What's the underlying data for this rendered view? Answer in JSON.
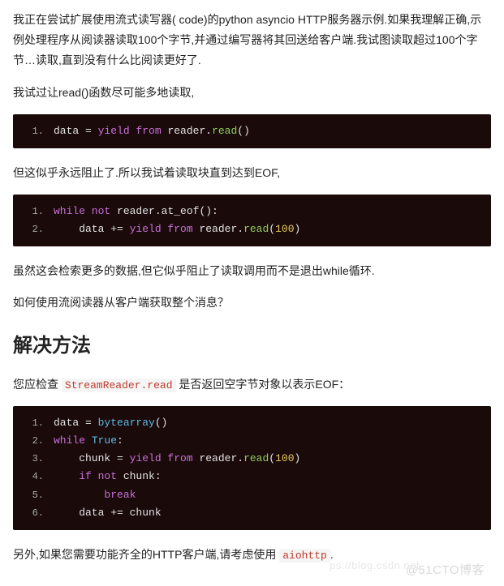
{
  "paragraphs": {
    "intro": "我正在尝试扩展使用流式读写器( code)的python asyncio HTTP服务器示例.如果我理解正确,示例处理程序从阅读器读取100个字节,并通过编写器将其回送给客户端.我试图读取超过100个字节…读取,直到没有什么比阅读更好了.",
    "trying_read": "我试过让read()函数尽可能多地读取,",
    "blocked_forever": "但这似乎永远阻止了.所以我试着读取块直到达到EOF,",
    "more_data": "虽然这会检索更多的数据,但它似乎阻止了读取调用而不是退出while循环.",
    "how_to": "如何使用流阅读器从客户端获取整个消息？",
    "check_eof_pre": "您应检查 ",
    "check_eof_code": "StreamReader.read",
    "check_eof_post": " 是否返回空字节对象以表示EOF：",
    "also_pre": "另外,如果您需要功能齐全的HTTP客户端,请考虑使用 ",
    "also_code": "aiohttp",
    "also_post": "."
  },
  "headings": {
    "solution": "解决方法"
  },
  "code": {
    "block1": [
      {
        "ln": "1.",
        "tokens": [
          {
            "c": "tok-var",
            "t": "data "
          },
          {
            "c": "tok-op",
            "t": "= "
          },
          {
            "c": "tok-kw",
            "t": "yield from "
          },
          {
            "c": "tok-var",
            "t": "reader"
          },
          {
            "c": "tok-dot",
            "t": "."
          },
          {
            "c": "tok-green",
            "t": "read"
          },
          {
            "c": "tok-paren",
            "t": "()"
          }
        ]
      }
    ],
    "block2": [
      {
        "ln": "1.",
        "tokens": [
          {
            "c": "tok-kw",
            "t": "while not "
          },
          {
            "c": "tok-var",
            "t": "reader"
          },
          {
            "c": "tok-dot",
            "t": "."
          },
          {
            "c": "tok-var",
            "t": "at_eof"
          },
          {
            "c": "tok-paren",
            "t": "():"
          }
        ]
      },
      {
        "ln": "2.",
        "tokens": [
          {
            "c": "tok-var",
            "t": "    data "
          },
          {
            "c": "tok-op",
            "t": "+= "
          },
          {
            "c": "tok-kw",
            "t": "yield from "
          },
          {
            "c": "tok-var",
            "t": "reader"
          },
          {
            "c": "tok-dot",
            "t": "."
          },
          {
            "c": "tok-green",
            "t": "read"
          },
          {
            "c": "tok-paren",
            "t": "("
          },
          {
            "c": "tok-yellow",
            "t": "100"
          },
          {
            "c": "tok-paren",
            "t": ")"
          }
        ]
      }
    ],
    "block3": [
      {
        "ln": "1.",
        "tokens": [
          {
            "c": "tok-var",
            "t": "data "
          },
          {
            "c": "tok-op",
            "t": "= "
          },
          {
            "c": "tok-obj",
            "t": "bytearray"
          },
          {
            "c": "tok-paren",
            "t": "()"
          }
        ]
      },
      {
        "ln": "2.",
        "tokens": [
          {
            "c": "tok-kw",
            "t": "while "
          },
          {
            "c": "tok-obj",
            "t": "True"
          },
          {
            "c": "tok-paren",
            "t": ":"
          }
        ]
      },
      {
        "ln": "3.",
        "tokens": [
          {
            "c": "tok-var",
            "t": "    chunk "
          },
          {
            "c": "tok-op",
            "t": "= "
          },
          {
            "c": "tok-kw",
            "t": "yield from "
          },
          {
            "c": "tok-var",
            "t": "reader"
          },
          {
            "c": "tok-dot",
            "t": "."
          },
          {
            "c": "tok-green",
            "t": "read"
          },
          {
            "c": "tok-paren",
            "t": "("
          },
          {
            "c": "tok-yellow",
            "t": "100"
          },
          {
            "c": "tok-paren",
            "t": ")"
          }
        ]
      },
      {
        "ln": "4.",
        "tokens": [
          {
            "c": "tok-var",
            "t": "    "
          },
          {
            "c": "tok-kw",
            "t": "if not "
          },
          {
            "c": "tok-var",
            "t": "chunk"
          },
          {
            "c": "tok-paren",
            "t": ":"
          }
        ]
      },
      {
        "ln": "5.",
        "tokens": [
          {
            "c": "tok-var",
            "t": "        "
          },
          {
            "c": "tok-break",
            "t": "break"
          }
        ]
      },
      {
        "ln": "6.",
        "tokens": [
          {
            "c": "tok-var",
            "t": "    data "
          },
          {
            "c": "tok-op",
            "t": "+= "
          },
          {
            "c": "tok-var",
            "t": "chunk"
          }
        ]
      }
    ]
  },
  "watermark": {
    "right": "@51CTO博客",
    "faint": "ps://blog.csdn.net"
  }
}
